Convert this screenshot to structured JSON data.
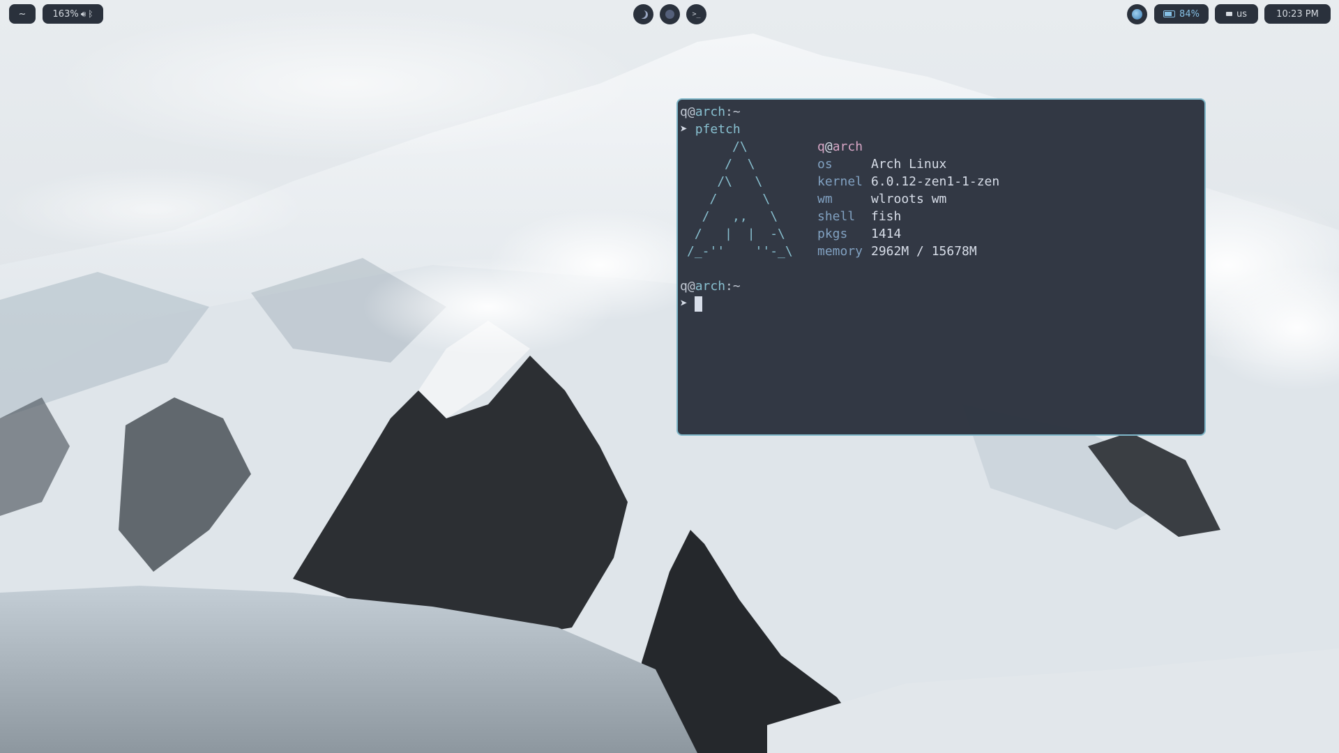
{
  "topbar": {
    "workspace_label": "~",
    "volume_label": "163%",
    "center_apps": [
      "moon-app",
      "circle-app",
      "terminal-app"
    ],
    "terminal_glyph": ">_",
    "battery_label": "84%",
    "keyboard_label": "us",
    "clock": "10:23 PM"
  },
  "terminal": {
    "prompt1": {
      "user": "q",
      "at": "@",
      "host": "arch",
      "sep": ":",
      "dir": "~"
    },
    "command": {
      "arrow": "➤",
      "text": "pfetch"
    },
    "logo": [
      "      /\\",
      "     /  \\",
      "    /\\   \\",
      "   /      \\",
      "  /   ,,   \\",
      " /   |  |  -\\",
      "/_-''    ''-_\\"
    ],
    "title": {
      "user": "q",
      "at": "@",
      "host": "arch"
    },
    "info": [
      {
        "key": "os",
        "value": "Arch Linux"
      },
      {
        "key": "kernel",
        "value": "6.0.12-zen1-1-zen"
      },
      {
        "key": "wm",
        "value": "wlroots wm"
      },
      {
        "key": "shell",
        "value": "fish"
      },
      {
        "key": "pkgs",
        "value": "1414"
      },
      {
        "key": "memory",
        "value": "2962M / 15678M"
      }
    ],
    "prompt2": {
      "user": "q",
      "at": "@",
      "host": "arch",
      "sep": ":",
      "dir": "~"
    },
    "prompt2_arrow": "➤"
  },
  "colors": {
    "bar_bg": "#2a313c",
    "terminal_bg": "#2e3440",
    "terminal_border": "#7fb7c9",
    "accent_cyan": "#88c0d0",
    "accent_pink": "#d8a6c6"
  }
}
